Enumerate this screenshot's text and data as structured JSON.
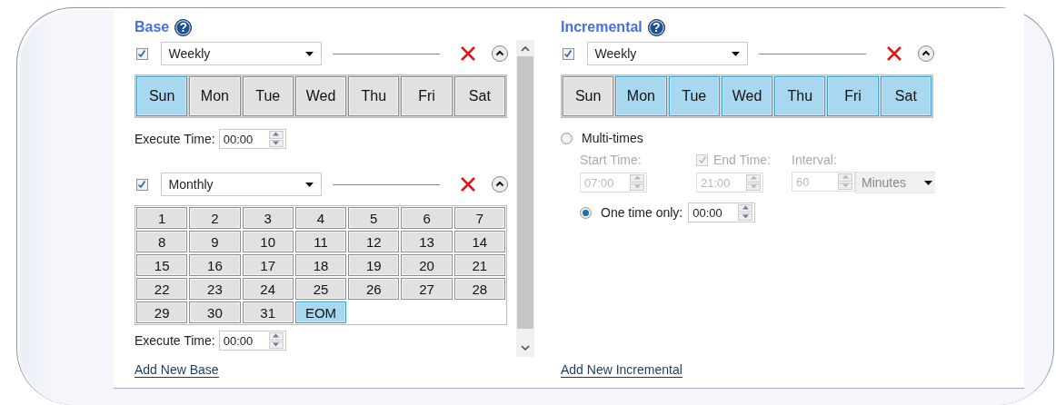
{
  "base": {
    "title": "Base",
    "help": "?",
    "schedules": [
      {
        "kind": "weekly",
        "enabled": true,
        "frequency": "Weekly",
        "days": [
          {
            "label": "Sun",
            "selected": true
          },
          {
            "label": "Mon",
            "selected": false
          },
          {
            "label": "Tue",
            "selected": false
          },
          {
            "label": "Wed",
            "selected": false
          },
          {
            "label": "Thu",
            "selected": false
          },
          {
            "label": "Fri",
            "selected": false
          },
          {
            "label": "Sat",
            "selected": false
          }
        ],
        "execute_time": {
          "label": "Execute Time:",
          "value": "00:00"
        }
      },
      {
        "kind": "monthly",
        "enabled": true,
        "frequency": "Monthly",
        "days": [
          {
            "label": "1",
            "selected": false
          },
          {
            "label": "2",
            "selected": false
          },
          {
            "label": "3",
            "selected": false
          },
          {
            "label": "4",
            "selected": false
          },
          {
            "label": "5",
            "selected": false
          },
          {
            "label": "6",
            "selected": false
          },
          {
            "label": "7",
            "selected": false
          },
          {
            "label": "8",
            "selected": false
          },
          {
            "label": "9",
            "selected": false
          },
          {
            "label": "10",
            "selected": false
          },
          {
            "label": "11",
            "selected": false
          },
          {
            "label": "12",
            "selected": false
          },
          {
            "label": "13",
            "selected": false
          },
          {
            "label": "14",
            "selected": false
          },
          {
            "label": "15",
            "selected": false
          },
          {
            "label": "16",
            "selected": false
          },
          {
            "label": "17",
            "selected": false
          },
          {
            "label": "18",
            "selected": false
          },
          {
            "label": "19",
            "selected": false
          },
          {
            "label": "20",
            "selected": false
          },
          {
            "label": "21",
            "selected": false
          },
          {
            "label": "22",
            "selected": false
          },
          {
            "label": "23",
            "selected": false
          },
          {
            "label": "24",
            "selected": false
          },
          {
            "label": "25",
            "selected": false
          },
          {
            "label": "26",
            "selected": false
          },
          {
            "label": "27",
            "selected": false
          },
          {
            "label": "28",
            "selected": false
          },
          {
            "label": "29",
            "selected": false
          },
          {
            "label": "30",
            "selected": false
          },
          {
            "label": "31",
            "selected": false
          },
          {
            "label": "EOM",
            "selected": true
          }
        ],
        "execute_time": {
          "label": "Execute Time:",
          "value": "00:00"
        }
      }
    ],
    "add_link": "Add New Base"
  },
  "incremental": {
    "title": "Incremental",
    "help": "?",
    "schedules": [
      {
        "kind": "weekly",
        "enabled": true,
        "frequency": "Weekly",
        "days": [
          {
            "label": "Sun",
            "selected": false
          },
          {
            "label": "Mon",
            "selected": true
          },
          {
            "label": "Tue",
            "selected": true
          },
          {
            "label": "Wed",
            "selected": true
          },
          {
            "label": "Thu",
            "selected": true
          },
          {
            "label": "Fri",
            "selected": true
          },
          {
            "label": "Sat",
            "selected": true
          }
        ],
        "multi_times": {
          "label": "Multi-times",
          "selected": false,
          "start_time": {
            "label": "Start Time:",
            "value": "07:00"
          },
          "end_time": {
            "label": "End Time:",
            "checked": true,
            "value": "21:00"
          },
          "interval": {
            "label": "Interval:",
            "value": "60",
            "unit": "Minutes"
          }
        },
        "one_time": {
          "label": "One time only:",
          "selected": true,
          "value": "00:00"
        }
      }
    ],
    "add_link": "Add New Incremental"
  }
}
